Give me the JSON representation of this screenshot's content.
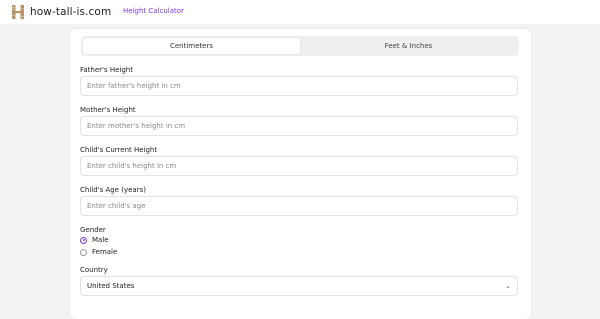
{
  "header": {
    "brand_name": "how-tall-is.com",
    "nav_link": "Height Calculator",
    "logo_icon": "h-ruler-logo-icon"
  },
  "tabs": [
    {
      "label": "Centimeters",
      "active": true
    },
    {
      "label": "Feet & Inches",
      "active": false
    }
  ],
  "form": {
    "father": {
      "label": "Father's Height",
      "placeholder": "Enter father's height in cm",
      "value": ""
    },
    "mother": {
      "label": "Mother's Height",
      "placeholder": "Enter mother's height in cm",
      "value": ""
    },
    "child": {
      "label": "Child's Current Height",
      "placeholder": "Enter child's height in cm",
      "value": ""
    },
    "age": {
      "label": "Child's Age (years)",
      "placeholder": "Enter child's age",
      "value": ""
    },
    "gender": {
      "label": "Gender",
      "options": [
        {
          "label": "Male",
          "checked": true
        },
        {
          "label": "Female",
          "checked": false
        }
      ]
    },
    "country": {
      "label": "Country",
      "value": "United States"
    }
  },
  "colors": {
    "accent": "#7c3aed",
    "brand_logo": "#b8946a"
  }
}
